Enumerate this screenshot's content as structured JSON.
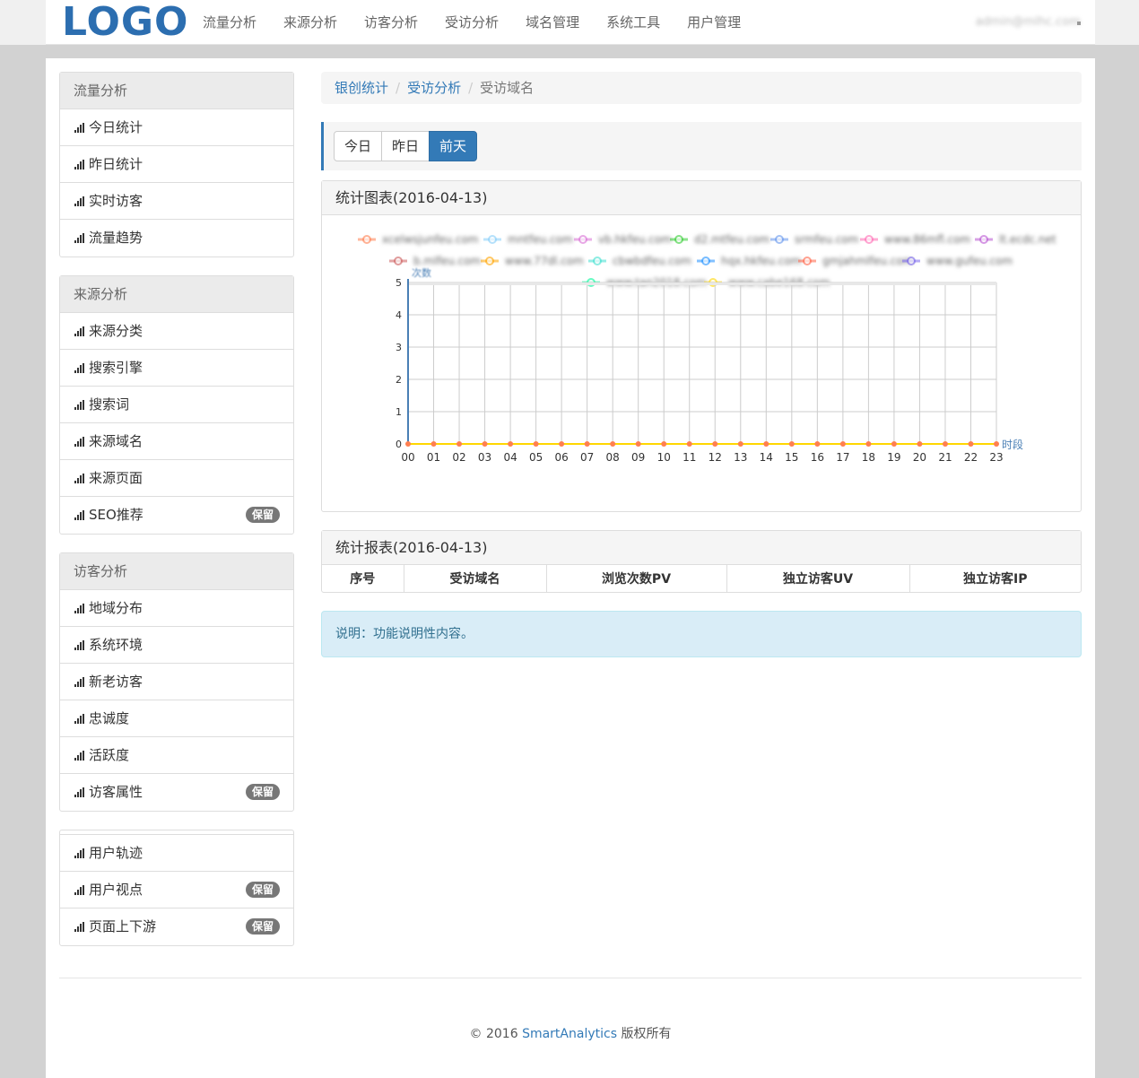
{
  "brand": {
    "logo": "LOGO"
  },
  "nav": {
    "items": [
      "流量分析",
      "来源分析",
      "访客分析",
      "受访分析",
      "域名管理",
      "系统工具",
      "用户管理"
    ]
  },
  "user": {
    "email": "admin@mlhc.com"
  },
  "sidebar": {
    "groups": [
      {
        "heading": "流量分析",
        "items": [
          {
            "label": "今日统计",
            "badge": ""
          },
          {
            "label": "昨日统计",
            "badge": ""
          },
          {
            "label": "实时访客",
            "badge": ""
          },
          {
            "label": "流量趋势",
            "badge": ""
          }
        ]
      },
      {
        "heading": "来源分析",
        "items": [
          {
            "label": "来源分类",
            "badge": ""
          },
          {
            "label": "搜索引擎",
            "badge": ""
          },
          {
            "label": "搜索词",
            "badge": ""
          },
          {
            "label": "来源域名",
            "badge": ""
          },
          {
            "label": "来源页面",
            "badge": ""
          },
          {
            "label": "SEO推荐",
            "badge": "保留"
          }
        ]
      },
      {
        "heading": "访客分析",
        "items": [
          {
            "label": "地域分布",
            "badge": ""
          },
          {
            "label": "系统环境",
            "badge": ""
          },
          {
            "label": "新老访客",
            "badge": ""
          },
          {
            "label": "忠诚度",
            "badge": ""
          },
          {
            "label": "活跃度",
            "badge": ""
          },
          {
            "label": "访客属性",
            "badge": "保留"
          }
        ]
      },
      {
        "heading": "",
        "items": [
          {
            "label": "用户轨迹",
            "badge": ""
          },
          {
            "label": "用户视点",
            "badge": "保留"
          },
          {
            "label": "页面上下游",
            "badge": "保留"
          }
        ]
      }
    ]
  },
  "breadcrumb": {
    "items": [
      "银创统计",
      "受访分析",
      "受访域名"
    ]
  },
  "day_buttons": {
    "today": "今日",
    "yesterday": "昨日",
    "before": "前天",
    "active": "before"
  },
  "chart_panel": {
    "title": "统计图表(2016-04-13)"
  },
  "chart_data": {
    "type": "line",
    "ylabel": "次数",
    "xlabel": "时段",
    "x": [
      "00",
      "01",
      "02",
      "03",
      "04",
      "05",
      "06",
      "07",
      "08",
      "09",
      "10",
      "11",
      "12",
      "13",
      "14",
      "15",
      "16",
      "17",
      "18",
      "19",
      "20",
      "21",
      "22",
      "23"
    ],
    "ylim": [
      0,
      5
    ],
    "yticks": [
      0,
      1,
      2,
      3,
      4,
      5
    ],
    "series": [
      {
        "name": "xcelwsjunfeu.com",
        "color": "#ff7f50",
        "values": [
          0,
          0,
          0,
          0,
          0,
          0,
          0,
          0,
          0,
          0,
          0,
          0,
          0,
          0,
          0,
          0,
          0,
          0,
          0,
          0,
          0,
          0,
          0,
          0
        ]
      },
      {
        "name": "mntfeu.com",
        "color": "#87cefa",
        "values": [
          0,
          0,
          0,
          0,
          0,
          0,
          0,
          0,
          0,
          0,
          0,
          0,
          0,
          0,
          0,
          0,
          0,
          0,
          0,
          0,
          0,
          0,
          0,
          0
        ]
      },
      {
        "name": "vb.hkfeu.com",
        "color": "#da70d6",
        "values": [
          0,
          0,
          0,
          0,
          0,
          0,
          0,
          0,
          0,
          0,
          0,
          0,
          0,
          0,
          0,
          0,
          0,
          0,
          0,
          0,
          0,
          0,
          0,
          0
        ]
      },
      {
        "name": "d2.mtfeu.com",
        "color": "#32cd32",
        "values": [
          0,
          0,
          0,
          0,
          0,
          0,
          0,
          0,
          0,
          0,
          0,
          0,
          0,
          0,
          0,
          0,
          0,
          0,
          0,
          0,
          0,
          0,
          0,
          0
        ]
      },
      {
        "name": "srmfeu.com",
        "color": "#6495ed",
        "values": [
          0,
          0,
          0,
          0,
          0,
          0,
          0,
          0,
          0,
          0,
          0,
          0,
          0,
          0,
          0,
          0,
          0,
          0,
          0,
          0,
          0,
          0,
          0,
          0
        ]
      },
      {
        "name": "www.86mfl.com",
        "color": "#ff69b4",
        "values": [
          0,
          0,
          0,
          0,
          0,
          0,
          0,
          0,
          0,
          0,
          0,
          0,
          0,
          0,
          0,
          0,
          0,
          0,
          0,
          0,
          0,
          0,
          0,
          0
        ]
      },
      {
        "name": "lt.ecdc.net",
        "color": "#ba55d3",
        "values": [
          0,
          0,
          0,
          0,
          0,
          0,
          0,
          0,
          0,
          0,
          0,
          0,
          0,
          0,
          0,
          0,
          0,
          0,
          0,
          0,
          0,
          0,
          0,
          0
        ]
      },
      {
        "name": "b.mlfeu.com",
        "color": "#cd5c5c",
        "values": [
          0,
          0,
          0,
          0,
          0,
          0,
          0,
          0,
          0,
          0,
          0,
          0,
          0,
          0,
          0,
          0,
          0,
          0,
          0,
          0,
          0,
          0,
          0,
          0
        ]
      },
      {
        "name": "www.77dl.com",
        "color": "#ffa500",
        "values": [
          0,
          0,
          0,
          0,
          0,
          0,
          0,
          0,
          0,
          0,
          0,
          0,
          0,
          0,
          0,
          0,
          0,
          0,
          0,
          0,
          0,
          0,
          0,
          0
        ]
      },
      {
        "name": "cbwbdfeu.com",
        "color": "#40e0d0",
        "values": [
          0,
          0,
          0,
          0,
          0,
          0,
          0,
          0,
          0,
          0,
          0,
          0,
          0,
          0,
          0,
          0,
          0,
          0,
          0,
          0,
          0,
          0,
          0,
          0
        ]
      },
      {
        "name": "hqx.hkfeu.com",
        "color": "#1e90ff",
        "values": [
          0,
          0,
          0,
          0,
          0,
          0,
          0,
          0,
          0,
          0,
          0,
          0,
          0,
          0,
          0,
          0,
          0,
          0,
          0,
          0,
          0,
          0,
          0,
          0
        ]
      },
      {
        "name": "gmjahmlfeu.com",
        "color": "#ff6347",
        "values": [
          0,
          0,
          0,
          0,
          0,
          0,
          0,
          0,
          0,
          0,
          0,
          0,
          0,
          0,
          0,
          0,
          0,
          0,
          0,
          0,
          0,
          0,
          0,
          0
        ]
      },
      {
        "name": "www.gufeu.com",
        "color": "#7b68ee",
        "values": [
          0,
          0,
          0,
          0,
          0,
          0,
          0,
          0,
          0,
          0,
          0,
          0,
          0,
          0,
          0,
          0,
          0,
          0,
          0,
          0,
          0,
          0,
          0,
          0
        ]
      },
      {
        "name": "www.tan2018.com",
        "color": "#00fa9a",
        "values": [
          0,
          0,
          0,
          0,
          0,
          0,
          0,
          0,
          0,
          0,
          0,
          0,
          0,
          0,
          0,
          0,
          0,
          0,
          0,
          0,
          0,
          0,
          0,
          0
        ]
      },
      {
        "name": "www.cabe168.com",
        "color": "#ffd700",
        "values": [
          0,
          0,
          0,
          0,
          0,
          0,
          0,
          0,
          0,
          0,
          0,
          0,
          0,
          0,
          0,
          0,
          0,
          0,
          0,
          0,
          0,
          0,
          0,
          0
        ]
      }
    ],
    "grid": true,
    "legend": "top"
  },
  "report_panel": {
    "title": "统计报表(2016-04-13)",
    "columns": [
      "序号",
      "受访域名",
      "浏览次数PV",
      "独立访客UV",
      "独立访客IP"
    ]
  },
  "note": {
    "text": "说明：功能说明性内容。"
  },
  "footer": {
    "copy": "© 2016 ",
    "brand": "SmartAnalytics",
    "rights": " 版权所有"
  },
  "colors": {
    "accent": "#337ab7",
    "logo": "#2c6eb0",
    "badge": "#777777",
    "info_bg": "#d9edf7"
  }
}
